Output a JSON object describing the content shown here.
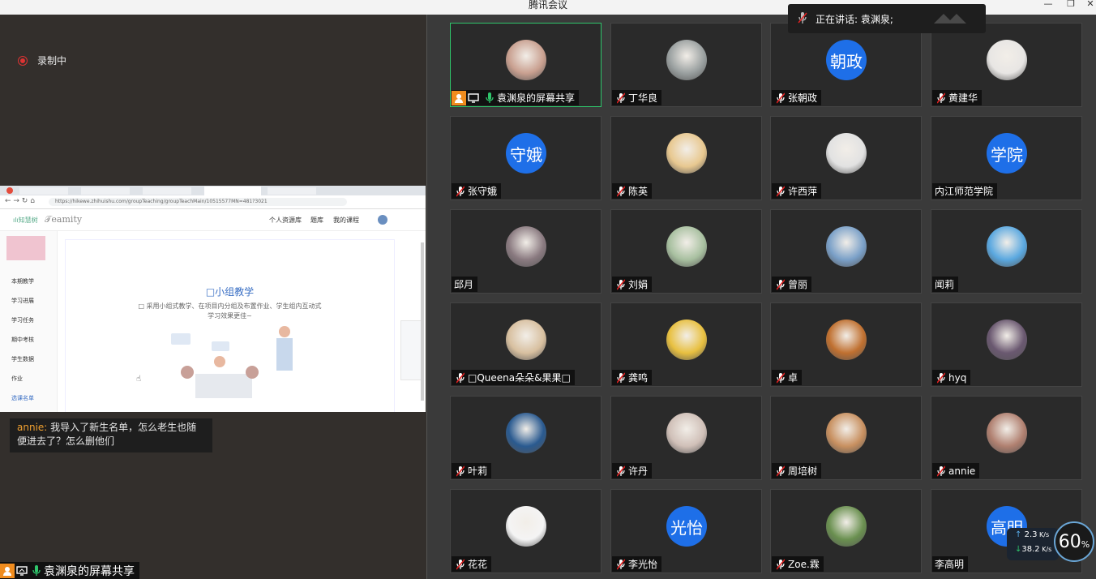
{
  "window": {
    "title": "腾讯会议"
  },
  "recording": {
    "label": "录制中"
  },
  "shared_screen": {
    "url": "https://hikewe.zhihuishu.com/groupTeaching/groupTeachMain/10515577MN=481?3021",
    "nav_items": [
      "个人资源库",
      "题库",
      "我的课程"
    ],
    "heading": "□小组教学",
    "desc_line1": "□ 采用小组式教学、在项目内分组及布置作业、学生组内互动式",
    "desc_line2": "学习效果更佳~",
    "side_items": [
      "本期教学",
      "学习进展",
      "学习任务",
      "期中考核",
      "学生数据",
      "作业",
      "选课名单"
    ]
  },
  "chat": {
    "author": "annie",
    "message": "我导入了新生名单，怎么老生也随便进去了？怎么删他们"
  },
  "bottom_share_label": "袁渊泉的屏幕共享",
  "speaking": {
    "label": "正在讲话: 袁渊泉;"
  },
  "participants": [
    {
      "name": "袁渊泉的屏幕共享",
      "avatar": "photo",
      "color": "#c9a090",
      "active": true,
      "mic": "on"
    },
    {
      "name": "丁华良",
      "avatar": "photo",
      "color": "#9aa0a0",
      "mic": "muted"
    },
    {
      "name": "张朝政",
      "avatar": "text",
      "text": "朝政",
      "mic": "muted"
    },
    {
      "name": "黄建华",
      "avatar": "photo",
      "color": "#e8e6e4",
      "mic": "muted"
    },
    {
      "name": "张守娥",
      "avatar": "text",
      "text": "守娥",
      "mic": "muted"
    },
    {
      "name": "陈英",
      "avatar": "photo",
      "color": "#e8c890",
      "mic": "muted"
    },
    {
      "name": "许西萍",
      "avatar": "photo",
      "color": "#e2e2e2",
      "mic": "muted"
    },
    {
      "name": "内江师范学院",
      "avatar": "text",
      "text": "学院",
      "mic": "none"
    },
    {
      "name": "邱月",
      "avatar": "photo",
      "color": "#8a7a80",
      "mic": "none"
    },
    {
      "name": "刘娟",
      "avatar": "photo",
      "color": "#a8c0a0",
      "mic": "muted"
    },
    {
      "name": "曾丽",
      "avatar": "photo",
      "color": "#7aa0c8",
      "mic": "muted"
    },
    {
      "name": "闻莉",
      "avatar": "photo",
      "color": "#5aa8e0",
      "mic": "none"
    },
    {
      "name": "□Queena朵朵&果果□",
      "avatar": "photo",
      "color": "#d8c0a0",
      "mic": "muted"
    },
    {
      "name": "龚鸣",
      "avatar": "photo",
      "color": "#e8c040",
      "mic": "muted"
    },
    {
      "name": "卓",
      "avatar": "photo",
      "color": "#c07030",
      "mic": "muted"
    },
    {
      "name": "hyq",
      "avatar": "photo",
      "color": "#6a5870",
      "mic": "muted"
    },
    {
      "name": "叶莉",
      "avatar": "photo",
      "color": "#2a5a90",
      "mic": "muted"
    },
    {
      "name": "许丹",
      "avatar": "photo",
      "color": "#d0c0b8",
      "mic": "muted"
    },
    {
      "name": "周培树",
      "avatar": "photo",
      "color": "#c89060",
      "mic": "muted"
    },
    {
      "name": "annie",
      "avatar": "photo",
      "color": "#b08070",
      "mic": "muted"
    },
    {
      "name": "花花",
      "avatar": "photo",
      "color": "#f4f4f4",
      "mic": "muted"
    },
    {
      "name": "李光怡",
      "avatar": "text",
      "text": "光怡",
      "mic": "muted"
    },
    {
      "name": "Zoe.霖",
      "avatar": "photo",
      "color": "#6a9050",
      "mic": "muted"
    },
    {
      "name": "李高明",
      "avatar": "text",
      "text": "高明",
      "mic": "none"
    }
  ],
  "network": {
    "up": "2.3",
    "down": "38.2",
    "unit": "K/s",
    "cpu": "60",
    "cpu_unit": "%"
  },
  "colors": {
    "active_border": "#2fc56b",
    "avatar_blue": "#1e6fe8",
    "mute_red": "#e02020",
    "mic_green": "#2fc56b"
  }
}
